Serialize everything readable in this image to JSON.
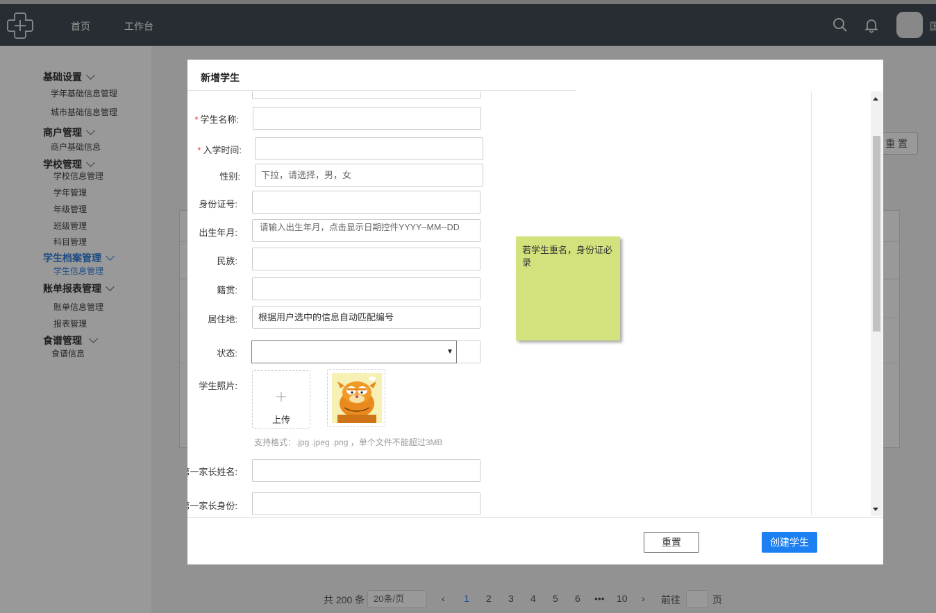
{
  "header": {
    "nav": [
      "首页",
      "工作台"
    ],
    "user_initial": "国"
  },
  "sidebar": {
    "groups": [
      {
        "label": "基础设置",
        "items": [
          "学年基础信息管理",
          "城市基础信息管理"
        ]
      },
      {
        "label": "商户管理",
        "items": [
          "商户基础信息"
        ]
      },
      {
        "label": "学校管理",
        "items": [
          "学校信息管理",
          "学年管理",
          "年级管理",
          "班级管理",
          "科目管理"
        ]
      },
      {
        "label": "学生档案管理",
        "items": [
          "学生信息管理"
        ],
        "active": true
      },
      {
        "label": "账单报表管理",
        "items": [
          "账单信息管理",
          "报表管理"
        ]
      },
      {
        "label": "食谱管理",
        "items": [
          "食谱信息"
        ]
      }
    ]
  },
  "background": {
    "reset_label": "重 置",
    "pagination": {
      "total": "共 200 条",
      "page_size": "20条/页",
      "prev": "‹",
      "pages": [
        "1",
        "2",
        "3",
        "4",
        "5",
        "6",
        "•••",
        "10"
      ],
      "current": "1",
      "next": "›",
      "goto_label": "前往",
      "goto_suffix": "页"
    }
  },
  "modal": {
    "title": "新增学生",
    "fields": {
      "student_name": {
        "label": "学生名称:",
        "required": true,
        "value": ""
      },
      "enroll_time": {
        "label": "入学时间:",
        "required": true,
        "value": ""
      },
      "gender": {
        "label": "性别:",
        "value": "下拉，请选择，男，女"
      },
      "id_number": {
        "label": "身份证号:",
        "value": ""
      },
      "birth": {
        "label": "出生年月:",
        "value": "请输入出生年月，点击显示日期控件YYYY--MM--DD"
      },
      "ethnicity": {
        "label": "民族:",
        "value": ""
      },
      "native_place": {
        "label": "籍贯:",
        "value": ""
      },
      "residence": {
        "label": "居住地:",
        "value": "根据用户选中的信息自动匹配编号"
      },
      "status": {
        "label": "状态:",
        "value": ""
      },
      "photo": {
        "label": "学生照片:",
        "upload_label": "上传",
        "photo_icon": "garfield-photo",
        "hint": "支持格式：.jpg .jpeg .png ，单个文件不能超过3MB"
      },
      "parent1_name": {
        "label": "第一家长姓名:",
        "value": ""
      },
      "parent1_identity": {
        "label": "第一家长身份:",
        "value": ""
      }
    },
    "note": "若学生重名，身份证必录",
    "footer": {
      "reset_label": "重置",
      "create_label": "创建学生"
    }
  },
  "colors": {
    "topbar": "#414b55",
    "accent": "#1c80f2",
    "required": "#e33333",
    "note": "#d3e27c"
  }
}
